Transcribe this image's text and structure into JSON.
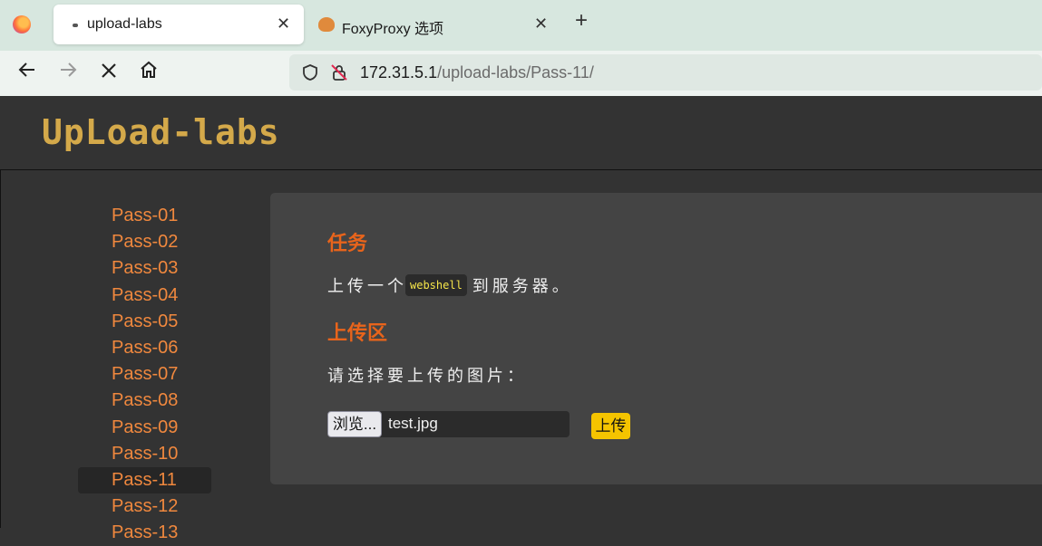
{
  "browser": {
    "tabs": [
      {
        "title": "upload-labs",
        "active": true
      },
      {
        "title": "FoxyProxy 选项",
        "active": false
      }
    ],
    "new_tab_label": "+",
    "close_label": "✕",
    "url": {
      "host": "172.31.5.1",
      "path": "/upload-labs/Pass-11/"
    }
  },
  "site": {
    "logo_text": "UpLoad-labs"
  },
  "sidebar": {
    "items": [
      {
        "label": "Pass-01"
      },
      {
        "label": "Pass-02"
      },
      {
        "label": "Pass-03"
      },
      {
        "label": "Pass-04"
      },
      {
        "label": "Pass-05"
      },
      {
        "label": "Pass-06"
      },
      {
        "label": "Pass-07"
      },
      {
        "label": "Pass-08"
      },
      {
        "label": "Pass-09"
      },
      {
        "label": "Pass-10"
      },
      {
        "label": "Pass-11",
        "active": true
      },
      {
        "label": "Pass-12"
      },
      {
        "label": "Pass-13"
      }
    ]
  },
  "main": {
    "task_heading": "任务",
    "task_text_before": "上传一个",
    "task_code": "webshell",
    "task_text_after": "到服务器。",
    "upload_heading": "上传区",
    "select_prompt": "请选择要上传的图片：",
    "browse_label": "浏览...",
    "file_name": "test.jpg",
    "submit_label": "上传"
  },
  "colors": {
    "accent_orange": "#e8641b",
    "menu_link": "#f0883e",
    "submit_yellow": "#f5c400",
    "logo_gold": "#d4a94a"
  }
}
